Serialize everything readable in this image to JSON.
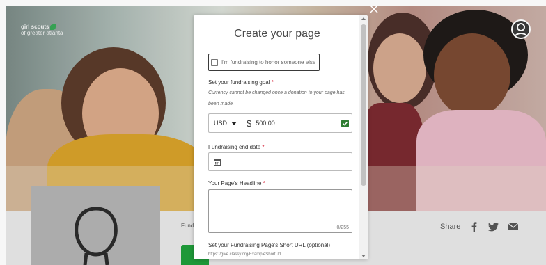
{
  "background": {
    "logo_line1": "girl scouts",
    "logo_line2": "of greater atlanta",
    "fundraise_label": "Fund",
    "share_label": "Share"
  },
  "modal": {
    "title": "Create your page",
    "honor_checkbox_label": "I'm fundraising to honor someone else",
    "goal": {
      "label": "Set your fundraising goal",
      "required_mark": "*",
      "note": "Currency cannot be changed once a donation to your page has been made.",
      "currency": "USD",
      "currency_symbol": "$",
      "amount": "500.00"
    },
    "end_date": {
      "label": "Fundraising end date",
      "required_mark": "*"
    },
    "headline": {
      "label": "Your Page's Headline",
      "required_mark": "*",
      "char_count": "0/255"
    },
    "short_url": {
      "label": "Set your Fundraising Page's Short URL (optional)",
      "placeholder": "https://give.classy.org/ExampleShortUrl"
    }
  },
  "colors": {
    "brand_green": "#1f9d3a",
    "required_red": "#d0021b",
    "valid_check": "#2e7d32"
  },
  "icons": [
    "close-icon",
    "calendar-icon",
    "check-icon",
    "facebook-icon",
    "twitter-icon",
    "mail-icon",
    "user-avatar-icon",
    "caret-down-icon"
  ]
}
